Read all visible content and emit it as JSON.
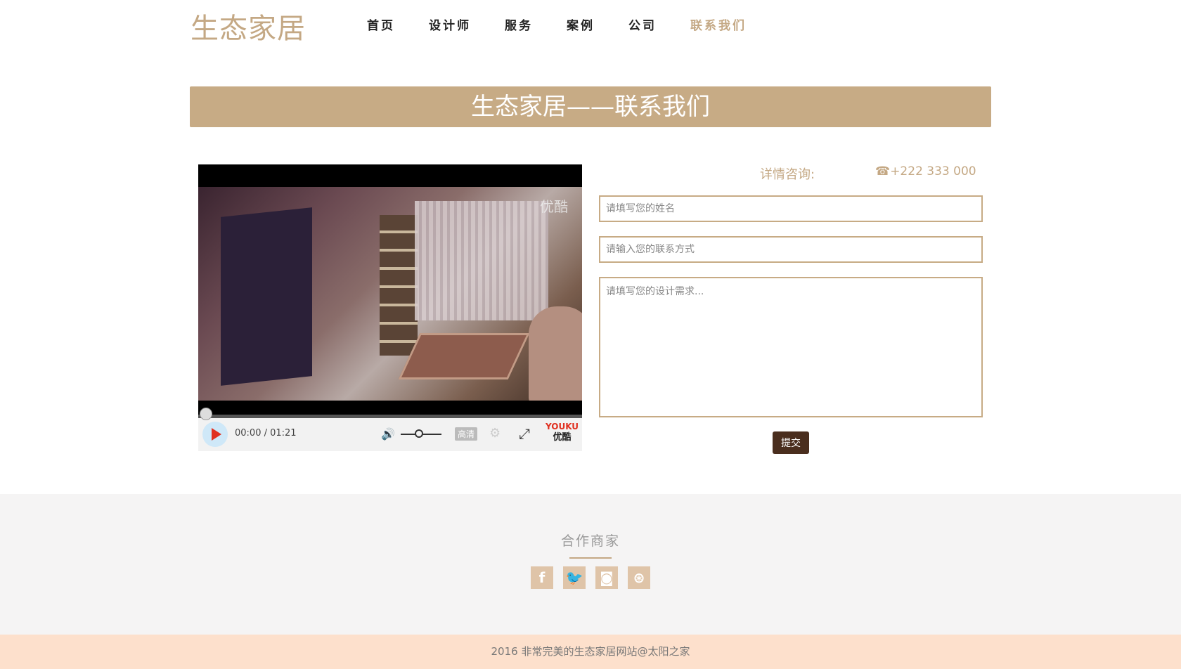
{
  "brand": "生态家居",
  "nav": [
    {
      "label": "首页"
    },
    {
      "label": "设计师"
    },
    {
      "label": "服务"
    },
    {
      "label": "案例"
    },
    {
      "label": "公司"
    },
    {
      "label": "联系我们",
      "active": true
    }
  ],
  "banner": {
    "title": "生态家居——联系我们"
  },
  "video": {
    "watermark": "优酷",
    "time": "00:00 / 01:21",
    "quality": "高清",
    "logo_top": "YOUKU",
    "logo_bottom": "优酷"
  },
  "contact": {
    "consult_label": "详情咨询:",
    "phone": "+222 333 000",
    "name_placeholder": "请填写您的姓名",
    "contact_placeholder": "请输入您的联系方式",
    "needs_placeholder": "请填写您的设计需求...",
    "submit_label": "提交"
  },
  "partners": {
    "title": "合作商家",
    "socials": [
      {
        "icon": "facebook-icon",
        "glyph": "f"
      },
      {
        "icon": "twitter-icon",
        "glyph": "🐦"
      },
      {
        "icon": "instagram-icon",
        "glyph": "◙"
      },
      {
        "icon": "dribbble-icon",
        "glyph": "⊛"
      }
    ]
  },
  "footer": {
    "text": "2016 非常完美的生态家居网站@太阳之家"
  },
  "colors": {
    "accent": "#c7ab85",
    "button": "#4a2e1e",
    "footer_bg": "#fde0cc"
  }
}
